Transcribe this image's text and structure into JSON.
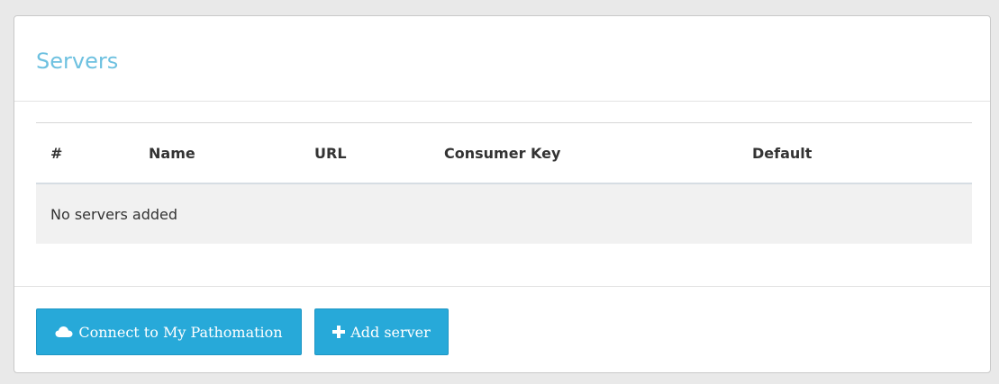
{
  "panel": {
    "title": "Servers"
  },
  "table": {
    "columns": [
      "#",
      "Name",
      "URL",
      "Consumer Key",
      "Default"
    ],
    "empty_message": "No servers added"
  },
  "footer": {
    "connect_label": "Connect to My Pathomation",
    "connect_icon": "cloud-icon",
    "add_label": "Add server",
    "add_icon": "plus-icon"
  },
  "colors": {
    "title": "#6ec1e0",
    "button": "#27a9d9"
  }
}
